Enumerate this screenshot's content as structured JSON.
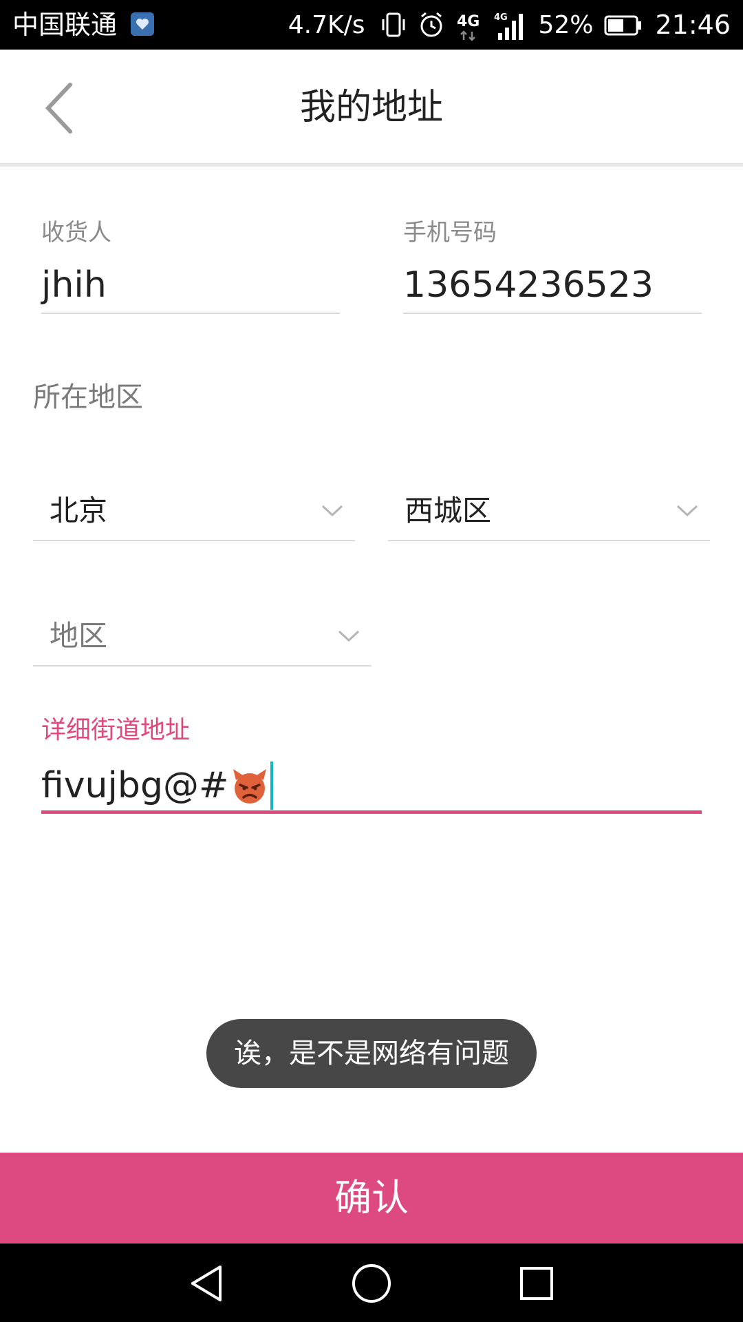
{
  "status_bar": {
    "carrier": "中国联通",
    "net_speed": "4.7K/s",
    "battery": "52%",
    "time": "21:46",
    "net_type": "4G",
    "net_type_small": "4G"
  },
  "header": {
    "title": "我的地址"
  },
  "form": {
    "consignee_label": "收货人",
    "consignee_value": "jhih",
    "phone_label": "手机号码",
    "phone_value": "13654236523",
    "region_label": "所在地区",
    "province_value": "北京",
    "city_value": "西城区",
    "district_placeholder": "地区",
    "street_label": "详细街道地址",
    "street_value": "fivujbg@#"
  },
  "toast": {
    "message": "诶，是不是网络有问题"
  },
  "confirm_button": {
    "label": "确认"
  },
  "colors": {
    "accent": "#dd4a80",
    "toast_bg": "#474747",
    "caret": "#14b8c4"
  }
}
